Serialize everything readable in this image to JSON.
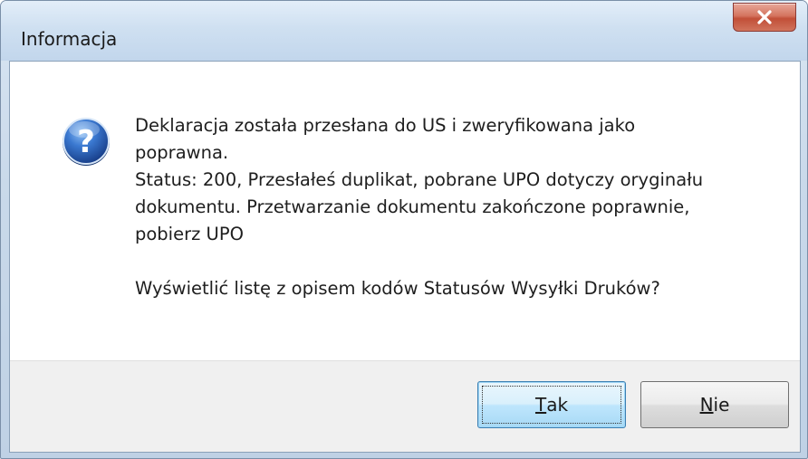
{
  "window": {
    "title": "Informacja"
  },
  "message": {
    "lines": [
      "Deklaracja została przesłana do US i zweryfikowana jako",
      "poprawna.",
      "Status: 200, Przesłałeś duplikat, pobrane UPO dotyczy oryginału",
      "dokumentu. Przetwarzanie dokumentu zakończone poprawnie,",
      "pobierz UPO"
    ],
    "question": "Wyświetlić listę z opisem kodów Statusów Wysyłki Druków?"
  },
  "buttons": {
    "yes": {
      "mnemonic": "T",
      "rest": "ak"
    },
    "no": {
      "mnemonic": "N",
      "rest": "ie"
    }
  },
  "icons": {
    "dialog": "question-icon",
    "close": "close-icon"
  },
  "colors": {
    "close_button": "#c24f38",
    "default_button_border": "#3c7fb1",
    "icon_blue": "#2a63b8"
  }
}
